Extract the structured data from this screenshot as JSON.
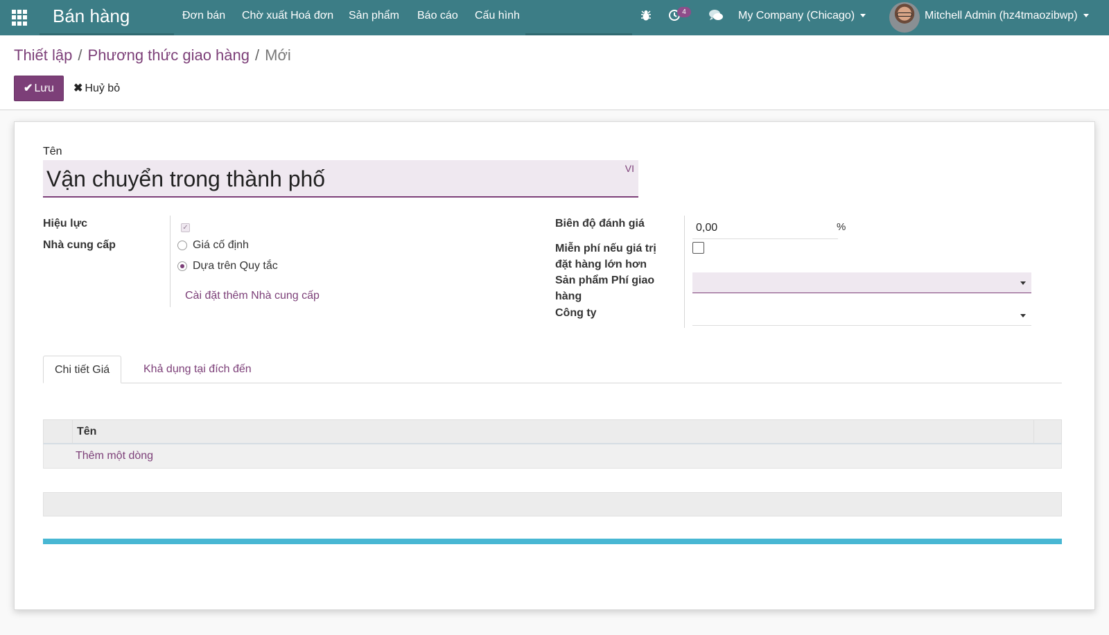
{
  "navbar": {
    "apps_icon": "apps-grid-icon",
    "brand": "Bán hàng",
    "menu": [
      "Đơn bán",
      "Chờ xuất Hoá đơn",
      "Sản phẩm",
      "Báo cáo",
      "Cấu hình"
    ],
    "debug_icon": "bug-icon",
    "activity_icon": "clock-icon",
    "activity_count": "4",
    "chat_icon": "chat-icon",
    "company": "My Company (Chicago)",
    "user": "Mitchell Admin (hz4tmaozibwp)",
    "bar_color": "#3c7d86"
  },
  "breadcrumb": {
    "items": [
      "Thiết lập",
      "Phương thức giao hàng"
    ],
    "separator": "/",
    "current": "Mới"
  },
  "actions": {
    "save_label": "Lưu",
    "cancel_label": "Huỷ bỏ",
    "accent_color": "#7c3f78"
  },
  "form": {
    "name_label": "Tên",
    "name_value": "Vận chuyển trong thành phố",
    "lang_tag": "VI",
    "active_label": "Hiệu lực",
    "active_checked": true,
    "provider_label": "Nhà cung cấp",
    "provider_options": [
      {
        "label": "Giá cố định",
        "selected": false
      },
      {
        "label": "Dựa trên Quy tắc",
        "selected": true
      }
    ],
    "install_more_link": "Cài đặt thêm Nhà cung cấp",
    "margin_label": "Biên độ đánh giá",
    "margin_value": "0,00",
    "margin_unit": "%",
    "free_label_line1": "Miễn phí nếu giá trị",
    "free_label_line2": "đặt hàng lớn hơn",
    "free_checked": false,
    "product_label_line1": "Sản phẩm Phí giao",
    "product_label_line2": "hàng",
    "product_value": "",
    "company_label": "Công ty",
    "company_value": ""
  },
  "tabs": [
    {
      "label": "Chi tiết Giá",
      "active": true
    },
    {
      "label": "Khả dụng tại đích đến",
      "active": false
    }
  ],
  "table": {
    "header_name": "Tên",
    "add_line": "Thêm một dòng",
    "rows": []
  }
}
